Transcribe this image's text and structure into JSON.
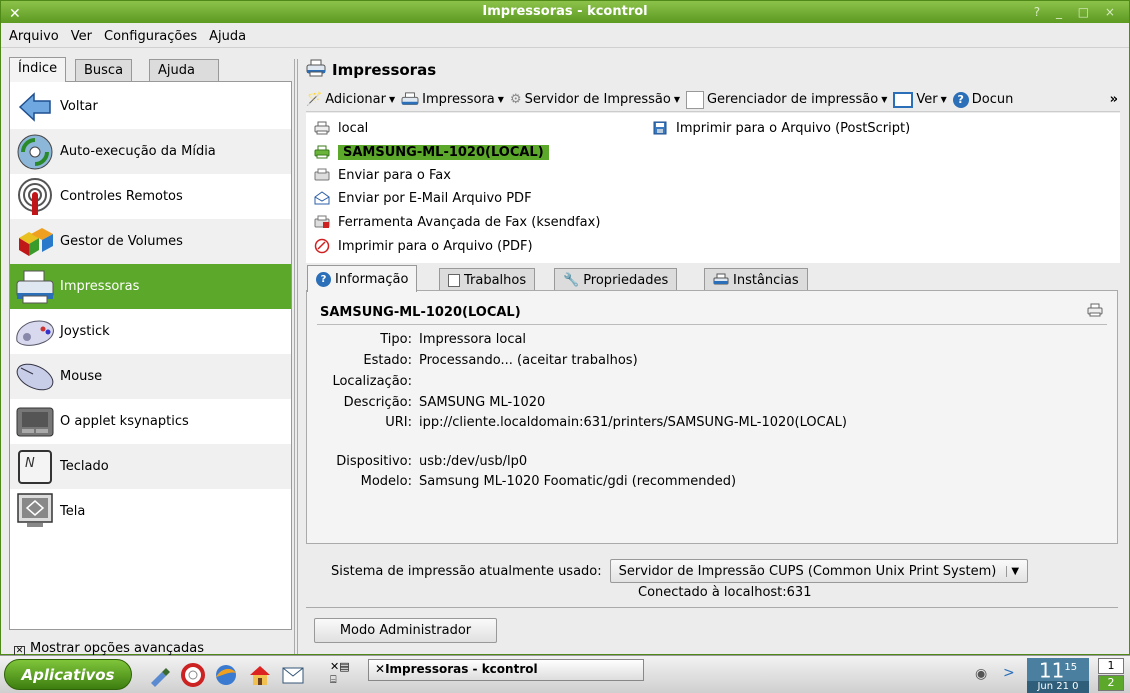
{
  "window": {
    "title": "Impressoras - kcontrol",
    "controls": "? _ □ ×"
  },
  "menubar": [
    "Arquivo",
    "Ver",
    "Configurações",
    "Ajuda"
  ],
  "left_tabs": [
    "Índice",
    "Busca",
    "Ajuda"
  ],
  "nav_items": [
    {
      "label": "Voltar",
      "icon": "back-arrow-icon"
    },
    {
      "label": "Auto-execução da Mídia",
      "icon": "media-autorun-icon"
    },
    {
      "label": "Controles Remotos",
      "icon": "remote-control-icon"
    },
    {
      "label": "Gestor de Volumes",
      "icon": "volumes-icon"
    },
    {
      "label": "Impressoras",
      "icon": "printer-icon",
      "selected": true
    },
    {
      "label": "Joystick",
      "icon": "joystick-icon"
    },
    {
      "label": "Mouse",
      "icon": "mouse-icon"
    },
    {
      "label": "O applet ksynaptics",
      "icon": "touchpad-icon"
    },
    {
      "label": "Teclado",
      "icon": "keyboard-icon"
    },
    {
      "label": "Tela",
      "icon": "display-icon"
    }
  ],
  "advanced_option": {
    "label": "Mostrar opções avançadas",
    "checked": true
  },
  "panel": {
    "title": "Impressoras"
  },
  "toolbar": [
    "Adicionar",
    "Impressora",
    "Servidor de Impressão",
    "Gerenciador de impressão",
    "Ver",
    "Docun",
    "»"
  ],
  "printers": [
    {
      "name": "local",
      "icon": "printer-local-icon"
    },
    {
      "name": "SAMSUNG-ML-1020(LOCAL)",
      "icon": "printer-active-icon",
      "selected": true
    },
    {
      "name": "Enviar para o Fax",
      "icon": "fax-icon"
    },
    {
      "name": "Enviar por E-Mail Arquivo PDF",
      "icon": "email-icon"
    },
    {
      "name": "Ferramenta Avançada de Fax (ksendfax)",
      "icon": "ksendfax-icon"
    },
    {
      "name": "Imprimir para o Arquivo (PDF)",
      "icon": "pdf-icon"
    },
    {
      "name": "Imprimir para o Arquivo (PostScript)",
      "icon": "save-file-icon"
    }
  ],
  "info_tabs": [
    "Informação",
    "Trabalhos",
    "Propriedades",
    "Instâncias"
  ],
  "info": {
    "heading": "SAMSUNG-ML-1020(LOCAL)",
    "rows": [
      {
        "key": "Tipo:",
        "value": "Impressora local"
      },
      {
        "key": "Estado:",
        "value": "Processando... (aceitar trabalhos)"
      },
      {
        "key": "Localização:",
        "value": ""
      },
      {
        "key": "Descrição:",
        "value": "SAMSUNG ML-1020"
      },
      {
        "key": "URI:",
        "value": "ipp://cliente.localdomain:631/printers/SAMSUNG-ML-1020(LOCAL)"
      },
      {
        "key": "Dispositivo:",
        "value": "usb:/dev/usb/lp0"
      },
      {
        "key": "Modelo:",
        "value": "Samsung ML-1020 Foomatic/gdi (recommended)"
      }
    ]
  },
  "print_system": {
    "label": "Sistema de impressão atualmente usado:",
    "value": "Servidor de Impressão CUPS (Common Unix Print System)",
    "status": "Conectado à localhost:631"
  },
  "admin_button": "Modo Administrador",
  "taskbar": {
    "start": "Aplicativos",
    "task": "Impressoras - kcontrol",
    "clock_hour": "11",
    "clock_min": "15",
    "clock_date": "Jun 21 0",
    "pages": [
      "1",
      "2"
    ]
  }
}
